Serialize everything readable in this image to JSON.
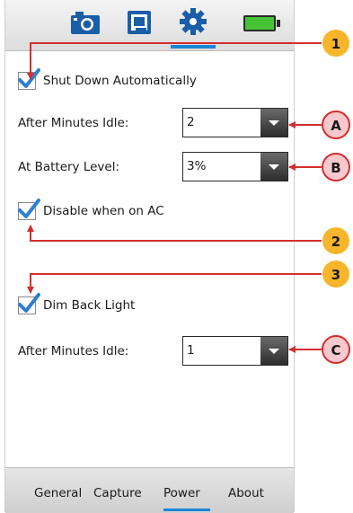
{
  "tabs": [
    {
      "name": "camera",
      "icon": "camera-icon"
    },
    {
      "name": "window",
      "icon": "window-icon"
    },
    {
      "name": "settings",
      "icon": "gear-icon",
      "active": true
    },
    {
      "name": "battery",
      "icon": "battery-icon"
    }
  ],
  "settings": {
    "shutdown_checkbox": {
      "label": "Shut Down Automatically",
      "checked": true
    },
    "after_idle": {
      "label": "After Minutes Idle:",
      "value": "2"
    },
    "battery_level": {
      "label": "At Battery Level:",
      "value": "3%"
    },
    "disable_ac": {
      "label": "Disable when on AC",
      "checked": true
    },
    "dim_backlight": {
      "label": "Dim Back Light",
      "checked": true
    },
    "dim_after_idle": {
      "label": "After Minutes Idle:",
      "value": "1"
    }
  },
  "bottom_tabs": [
    "General",
    "Capture",
    "Power",
    "About"
  ],
  "active_bottom_tab": "Power",
  "callouts": {
    "one": "1",
    "two": "2",
    "three": "3",
    "a": "A",
    "b": "B",
    "c": "C"
  },
  "colors": {
    "accent": "#1e86d8",
    "callout_yellow": "#f7b52c",
    "callout_pink": "#f7c9cf",
    "callout_red": "#d32f2f",
    "battery_green": "#46c236"
  }
}
